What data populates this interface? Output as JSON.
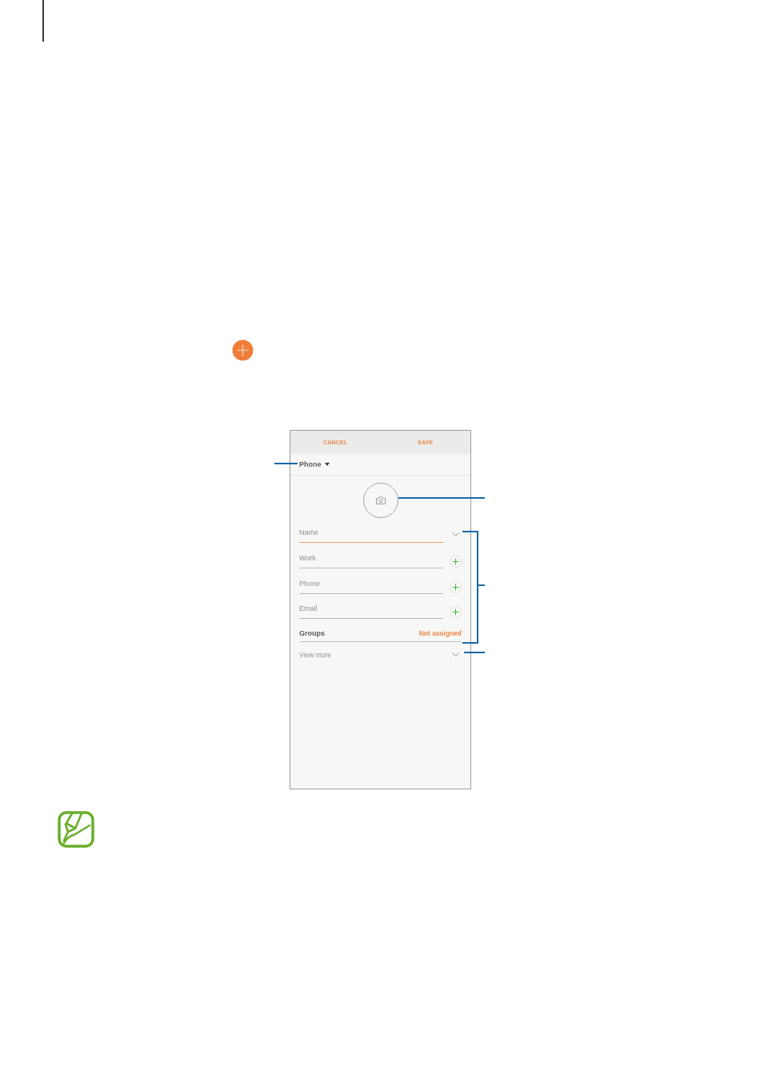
{
  "screen": {
    "toolbar": [
      {
        "label": "CANCEL"
      },
      {
        "label": "SAVE"
      }
    ],
    "storage": {
      "label": "Phone"
    },
    "fields": [
      {
        "placeholder": "Name",
        "focused": true,
        "kind": "expand"
      },
      {
        "placeholder": "Work",
        "focused": false,
        "kind": "add"
      },
      {
        "placeholder": "Phone",
        "focused": false,
        "kind": "add"
      },
      {
        "placeholder": "Email",
        "focused": false,
        "kind": "add"
      }
    ],
    "groups": {
      "label": "Groups",
      "value": "Not assigned"
    },
    "view_more": {
      "label": "View more"
    }
  }
}
